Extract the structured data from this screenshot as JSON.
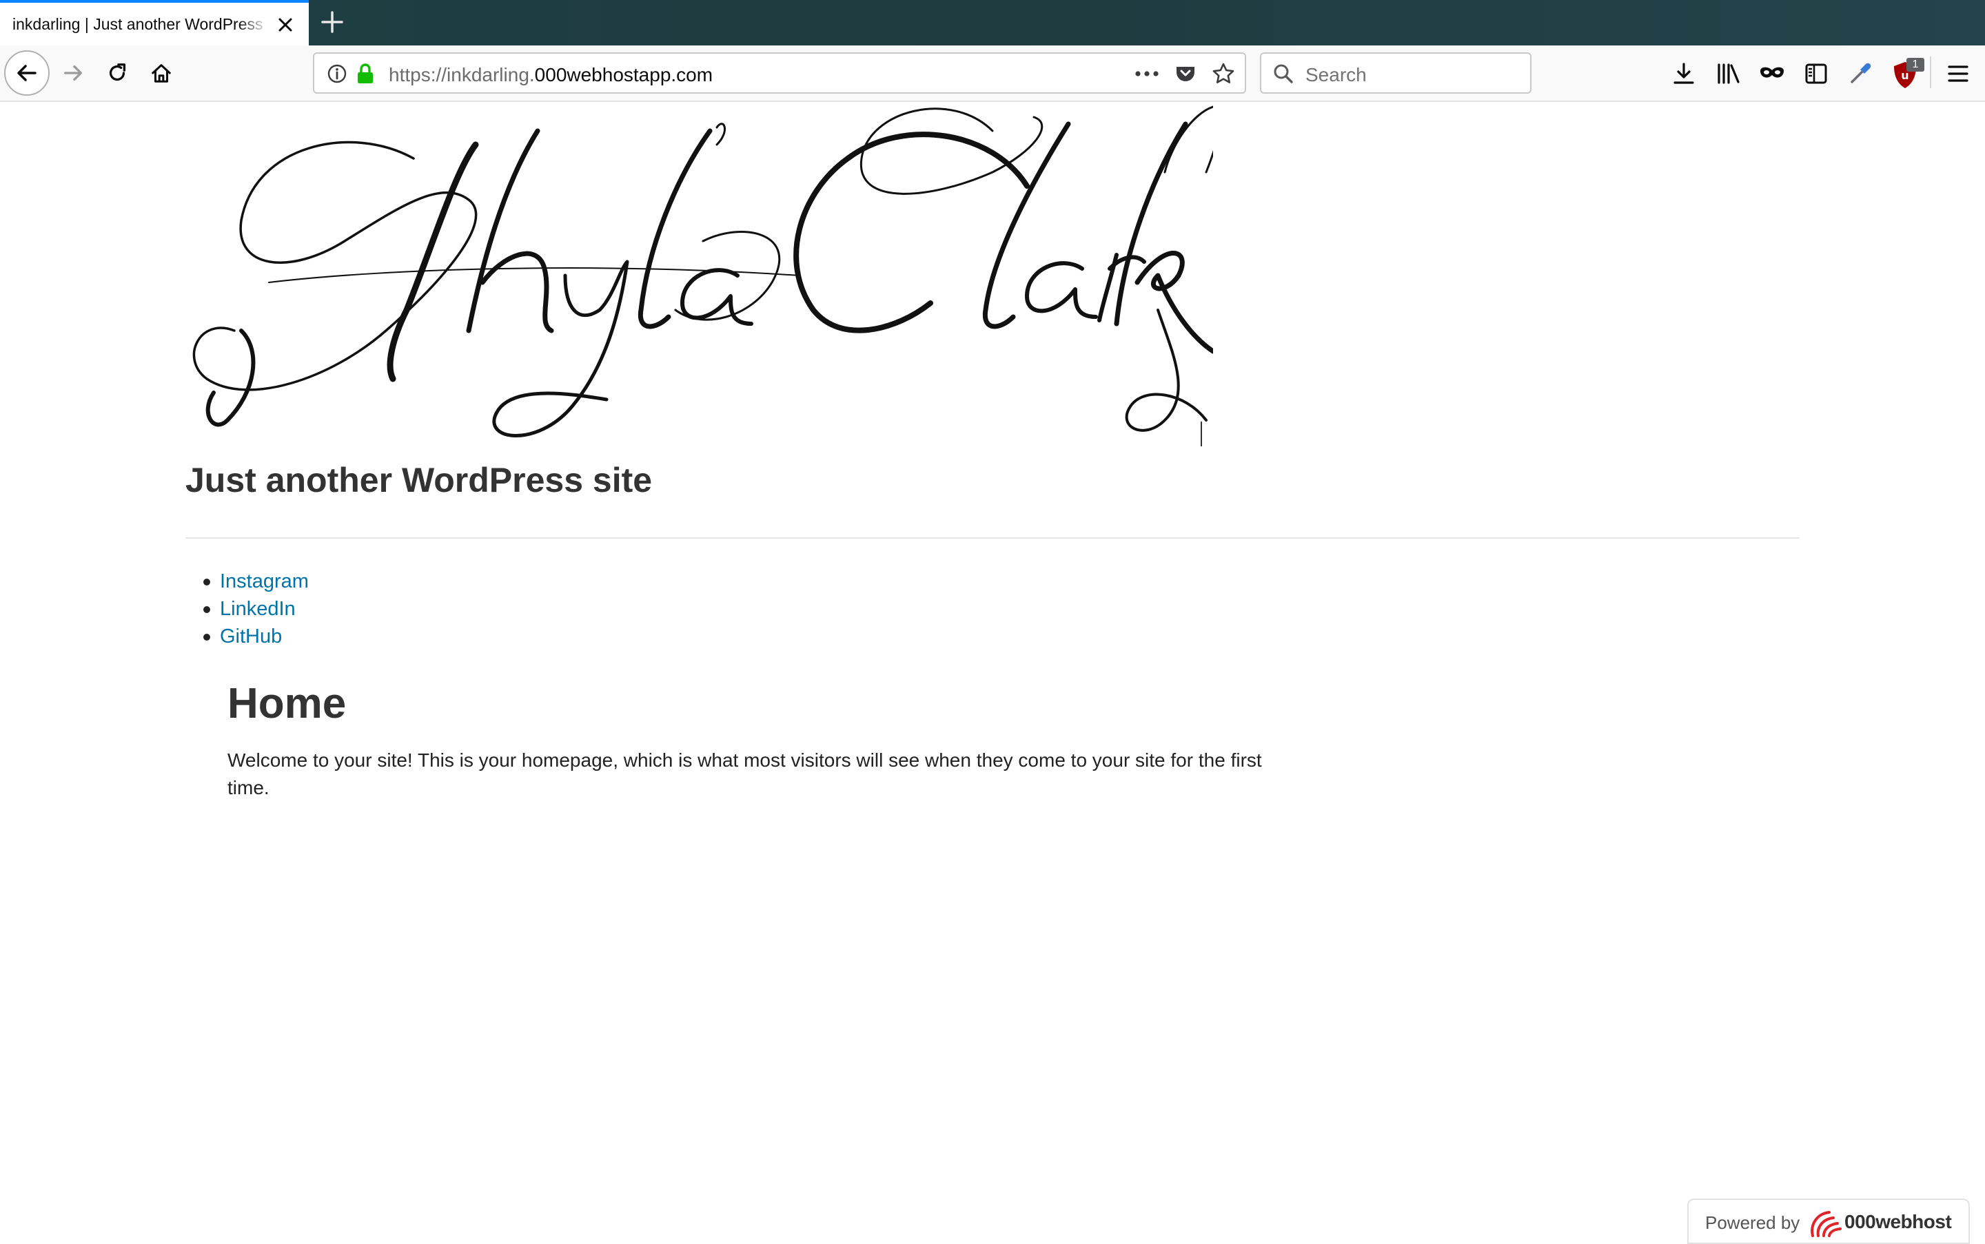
{
  "browser": {
    "tab": {
      "title": "inkdarling | Just another WordPress site"
    },
    "url": {
      "prefix": "https://inkdarling.",
      "domain": "000webhostapp.com"
    },
    "search": {
      "placeholder": "Search"
    },
    "addon_badge": "1"
  },
  "site": {
    "logo_text": "Shyla Clark",
    "description": "Just another WordPress site",
    "social_links": [
      {
        "label": "Instagram"
      },
      {
        "label": "LinkedIn"
      },
      {
        "label": "GitHub"
      }
    ]
  },
  "page": {
    "title": "Home",
    "content": "Welcome to your site! This is your homepage, which is what most visitors will see when they come to your site for the first time."
  },
  "footer_badge": {
    "label": "Powered by",
    "brand": "000webhost"
  },
  "colors": {
    "link": "#0073aa",
    "tab_accent": "#0a84ff",
    "lock_green": "#12bc00",
    "ublock_red": "#a50000",
    "webhost_red": "#e0242a"
  }
}
